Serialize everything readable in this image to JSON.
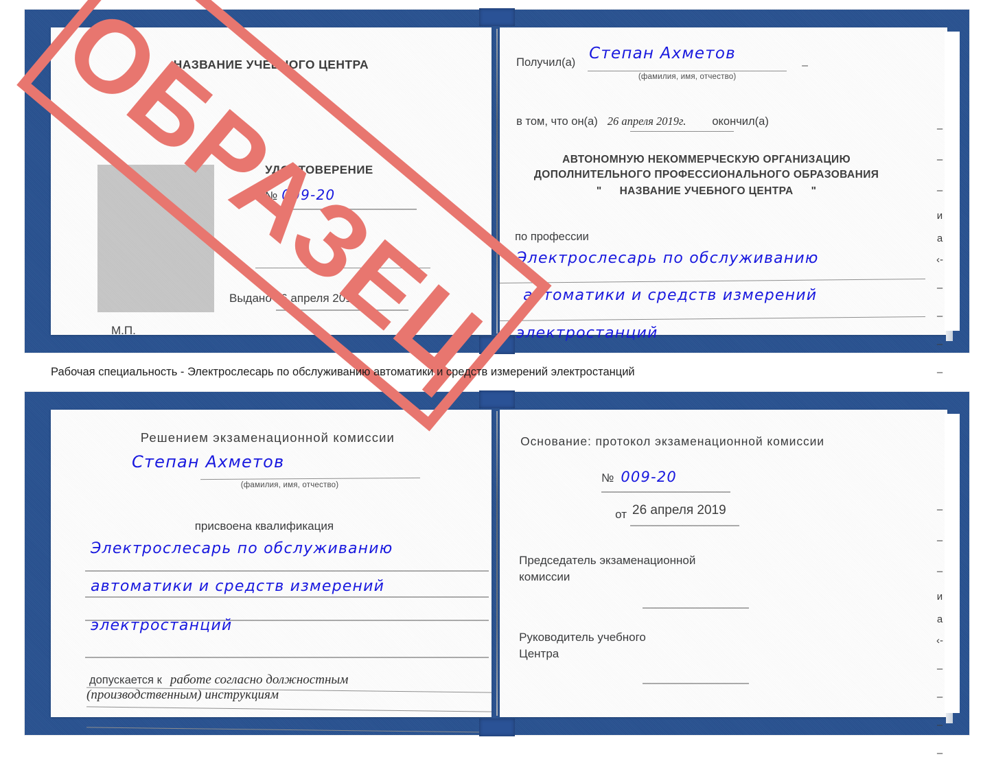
{
  "caption": {
    "text": "Рабочая специальность - Электрослесарь по обслуживанию автоматики и средств измерений электростанций"
  },
  "watermark": {
    "label": "ОБРАЗЕЦ",
    "color": "#e8766f"
  },
  "colors": {
    "cover_blue": "#27508f",
    "handwriting_blue": "#1414e0",
    "photo_placeholder_gray": "#c6c6c6",
    "rule_gray": "#8d8d8d",
    "text_black": "#2b2b2b"
  },
  "certificate_top": {
    "left_page": {
      "center_name": "НАЗВАНИЕ УЧЕБНОГО ЦЕНТРА",
      "doc_title": "УДОСТОВЕРЕНИЕ",
      "number_label": "№",
      "number_value": "009-20",
      "issued_label": "Выдано",
      "issued_value": "26 апреля 2019",
      "seal_label": "М.П."
    },
    "right_page": {
      "received_label": "Получил(а)",
      "received_value": "Степан Ахметов",
      "fio_hint": "(фамилия, имя, отчество)",
      "that_he_label": "в том, что он(а)",
      "finish_date": "26 апреля 2019г.",
      "finished_label": "окончил(а)",
      "org_line1": "АВТОНОМНУЮ НЕКОММЕРЧЕСКУЮ ОРГАНИЗАЦИЮ",
      "org_line2": "ДОПОЛНИТЕЛЬНОГО ПРОФЕССИОНАЛЬНОГО ОБРАЗОВАНИЯ",
      "org_quote_open": "\"",
      "org_line3": "НАЗВАНИЕ УЧЕБНОГО ЦЕНТРА",
      "org_quote_close": "\"",
      "profession_label": "по профессии",
      "profession_line1": "Электрослесарь по обслуживанию",
      "profession_line2": "автоматики и средств измерений",
      "profession_line3": "электростанций",
      "edge_ghost_chars": [
        "–",
        "–",
        "–",
        "и",
        "а",
        "‹-",
        "–",
        "–",
        "–",
        "–"
      ]
    }
  },
  "certificate_bottom": {
    "left_page": {
      "heading": "Решением экзаменационной комиссии",
      "name_value": "Степан Ахметов",
      "fio_hint": "(фамилия, имя, отчество)",
      "qualification_label": "присвоена квалификация",
      "qualification_line1": "Электрослесарь по обслуживанию",
      "qualification_line2": "автоматики и средств измерений",
      "qualification_line3": "электростанций",
      "admitted_label": "допускается к",
      "admitted_value_line1": "работе согласно должностным",
      "admitted_value_line2": "(производственным) инструкциям"
    },
    "right_page": {
      "basis_label": "Основание: протокол экзаменационной комиссии",
      "number_label": "№",
      "number_value": "009-20",
      "date_label": "от",
      "date_value": "26 апреля 2019",
      "chairman_line1": "Председатель экзаменационной",
      "chairman_line2": "комиссии",
      "head_line1": "Руководитель учебного",
      "head_line2": "Центра",
      "edge_ghost_chars": [
        "–",
        "–",
        "–",
        "и",
        "а",
        "‹-",
        "–",
        "–",
        "–",
        "–"
      ]
    }
  }
}
